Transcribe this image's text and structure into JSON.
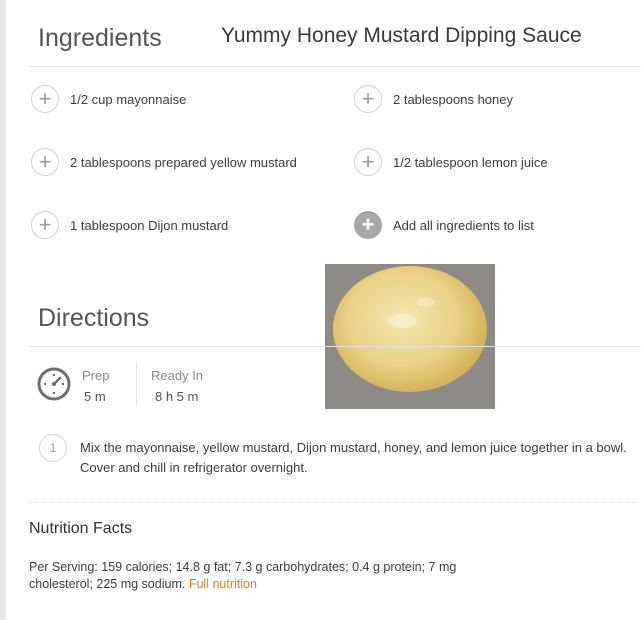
{
  "ingredients_heading": "Ingredients",
  "recipe_title": "Yummy Honey Mustard Dipping Sauce",
  "ingredients": [
    {
      "label": "1/2 cup mayonnaise"
    },
    {
      "label": "2 tablespoons honey"
    },
    {
      "label": "2 tablespoons prepared yellow mustard"
    },
    {
      "label": "1/2 tablespoon lemon juice"
    },
    {
      "label": "1 tablespoon Dijon mustard"
    }
  ],
  "add_all": {
    "label": "Add all ingredients to list",
    "icon": "plus-icon"
  },
  "directions_heading": "Directions",
  "times": {
    "prep_label": "Prep",
    "prep_value": "5 m",
    "ready_label": "Ready In",
    "ready_value": "8 h 5 m",
    "icon": "timer-icon"
  },
  "steps": [
    {
      "number": "1",
      "text": "Mix the mayonnaise, yellow mustard, Dijon mustard, honey, and lemon juice together in a bowl. Cover and chill in refrigerator overnight."
    }
  ],
  "nutrition": {
    "heading": "Nutrition Facts",
    "text": "Per Serving: 159 calories; 14.8 g fat; 7.3 g carbohydrates; 0.4 g protein; 7 mg cholesterol; 225 mg sodium.",
    "link": "Full nutrition"
  },
  "colors": {
    "accent_link": "#e07b1a",
    "icon_gray": "#a8a8a8"
  }
}
